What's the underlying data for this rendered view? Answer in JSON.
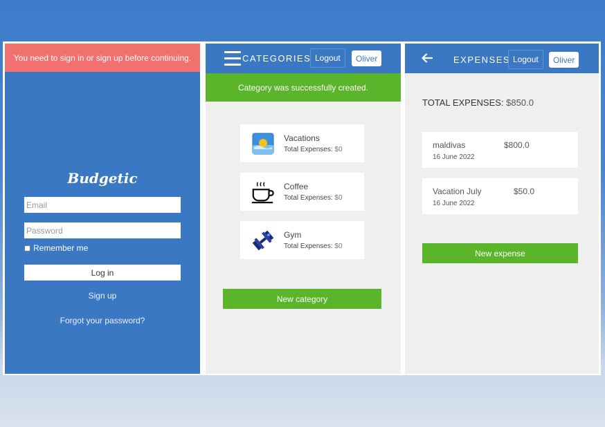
{
  "login": {
    "alert": "You need to sign in or sign up before continuing.",
    "brand": "Budgetic",
    "email_placeholder": "Email",
    "password_placeholder": "Password",
    "remember_label": "Remember me",
    "login_button": "Log in",
    "signup_link": "Sign up",
    "forgot_link": "Forgot your password?"
  },
  "categories_screen": {
    "title": "CATEGORIES",
    "logout": "Logout",
    "user": "Oliver",
    "notice": "Category was successfully created.",
    "items": [
      {
        "name": "Vacations",
        "expenses_label": "Total Expenses:",
        "expenses_value": "$0",
        "icon": "beach-sun-icon"
      },
      {
        "name": "Coffee",
        "expenses_label": "Total Expenses:",
        "expenses_value": "$0",
        "icon": "coffee-cup-icon"
      },
      {
        "name": "Gym",
        "expenses_label": "Total Expenses:",
        "expenses_value": "$0",
        "icon": "dumbbell-icon"
      }
    ],
    "new_button": "New category"
  },
  "expenses_screen": {
    "title": "EXPENSES",
    "logout": "Logout",
    "user": "Oliver",
    "total_label": "TOTAL EXPENSES:",
    "total_value": "$850.0",
    "items": [
      {
        "name": "maldivas",
        "amount": "$800.0",
        "date": "16 June 2022"
      },
      {
        "name": "Vacation July",
        "amount": "$50.0",
        "date": "16 June 2022"
      }
    ],
    "new_button": "New expense"
  },
  "colors": {
    "primary_blue": "#3a78c4",
    "success_green": "#5ab52a",
    "alert_red": "#f2706e"
  }
}
